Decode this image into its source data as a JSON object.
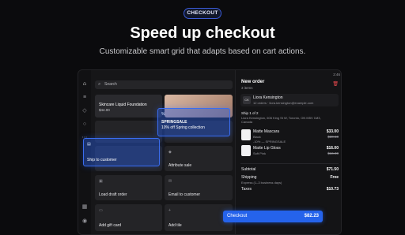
{
  "badge": "CHECKOUT",
  "headline": "Speed up checkout",
  "subheadline": "Customizable smart grid that adapts based on cart actions.",
  "search": {
    "placeholder": "Search"
  },
  "grid": {
    "product_title": "Skincare Liquid Foundation",
    "product_price": "$44.00",
    "discount_title": "SPRINGSALE",
    "discount_desc": "10% off Spring collection",
    "ship_to_customer": "Ship to customer",
    "attribute_sale": "Attribute sale",
    "load_draft_order": "Load draft order",
    "email_to_customer": "Email to customer",
    "add_gift_card": "Add gift card",
    "add_tile": "Add tile"
  },
  "status_bar": {
    "time": "2:46"
  },
  "order": {
    "title": "New order",
    "item_count": "3 items",
    "customer_initials": "CK",
    "customer_name": "Liora Kensington",
    "customer_detail": "12 orders · liora.kensington@example.com",
    "ship_label": "Ship 1 of 2",
    "ship_address": "Liora Kensington, 606 King St W, Toronto, ON M5V 1M3, Canada",
    "items": [
      {
        "name": "Matte Mascara",
        "variant": "Black",
        "promo": "-10% — SPRINGSALE",
        "price": "$33.00",
        "orig": "$30.50"
      },
      {
        "name": "Matte Lip Gloss",
        "variant": "Soft Pink",
        "promo": "",
        "price": "$16.00",
        "orig": "$16.00"
      }
    ],
    "subtotal_label": "Subtotal",
    "subtotal_value": "$71.50",
    "shipping_label": "Shipping",
    "shipping_detail": "Express (1–3 business days)",
    "shipping_value": "Free",
    "taxes_label": "Taxes",
    "taxes_value": "$10.73",
    "checkout_label": "Checkout",
    "checkout_total": "$82.23"
  }
}
